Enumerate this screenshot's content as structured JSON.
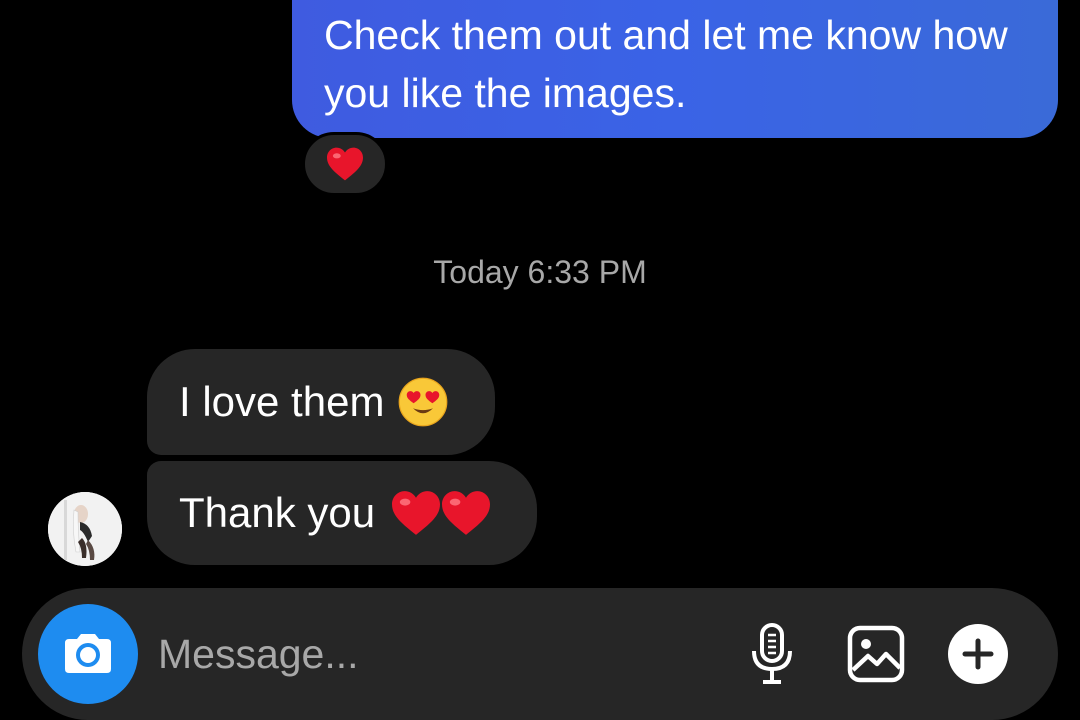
{
  "conversation": {
    "outgoing_message": "Check them out and let me know how you like the images.",
    "reaction_emoji": "heart",
    "timestamp": "Today 6:33 PM",
    "incoming_messages": [
      {
        "text": "I love them",
        "emoji": "heart-eyes"
      },
      {
        "text": "Thank you",
        "emoji": "two-hearts"
      }
    ]
  },
  "composer": {
    "placeholder": "Message...",
    "value": "",
    "icons": [
      "camera-icon",
      "microphone-icon",
      "gallery-icon",
      "plus-icon"
    ]
  },
  "colors": {
    "outgoing_bubble": "#3a63e6",
    "incoming_bubble": "#262626",
    "camera_button": "#1e8cf0",
    "timestamp": "#a8a8a8",
    "heart": "#e8152b"
  }
}
